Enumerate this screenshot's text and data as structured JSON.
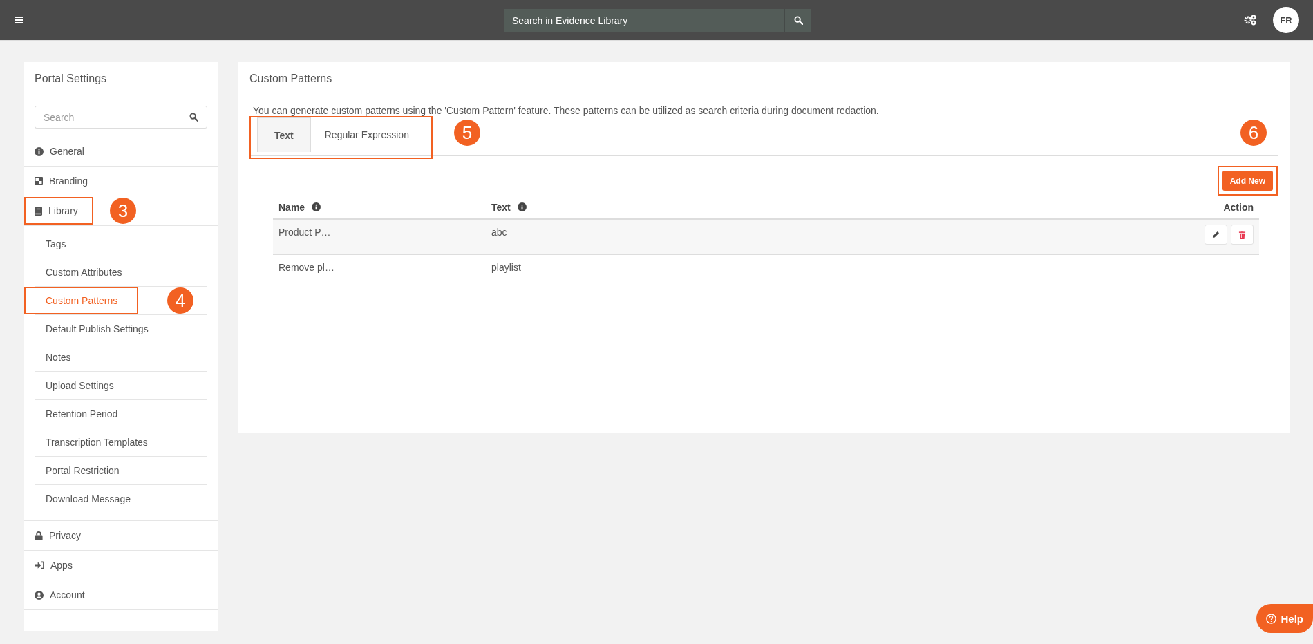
{
  "topbar": {
    "search": {
      "placeholder": "Search in Evidence Library"
    },
    "avatar": "FR"
  },
  "sidebar": {
    "title": "Portal Settings",
    "search": {
      "placeholder": "Search"
    },
    "items": [
      {
        "label": "General",
        "kind": "info",
        "selected": false
      },
      {
        "label": "Branding",
        "kind": "branding",
        "selected": false
      },
      {
        "label": "Library",
        "kind": "book",
        "selected": false,
        "callout": "3",
        "children": [
          {
            "label": "Tags",
            "selected": false
          },
          {
            "label": "Custom Attributes",
            "selected": false
          },
          {
            "label": "Custom Patterns",
            "selected": true,
            "callout": "4"
          },
          {
            "label": "Default Publish Settings",
            "selected": false
          },
          {
            "label": "Notes",
            "selected": false
          },
          {
            "label": "Upload Settings",
            "selected": false
          },
          {
            "label": "Retention Period",
            "selected": false
          },
          {
            "label": "Transcription Templates",
            "selected": false
          },
          {
            "label": "Portal Restriction",
            "selected": false
          },
          {
            "label": "Download Message",
            "selected": false
          }
        ]
      },
      {
        "label": "Privacy",
        "kind": "lock",
        "selected": false
      },
      {
        "label": "Apps",
        "kind": "signin",
        "selected": false
      },
      {
        "label": "Account",
        "kind": "user",
        "selected": false
      }
    ]
  },
  "main": {
    "title": "Custom Patterns",
    "description": "You can generate custom patterns using the 'Custom Pattern' feature. These patterns can be utilized as search criteria during document redaction.",
    "tabs": [
      {
        "label": "Text",
        "selected": true
      },
      {
        "label": "Regular Expression",
        "selected": false
      }
    ],
    "tabs_callout": "5",
    "add_button": {
      "label": "Add New",
      "callout": "6"
    },
    "table": {
      "columns": [
        {
          "label": "Name",
          "info": true
        },
        {
          "label": "Text",
          "info": true
        },
        {
          "label": "Action",
          "info": false
        }
      ],
      "rows": [
        {
          "cells": [
            "Product P…",
            "abc"
          ],
          "hovered": true
        },
        {
          "cells": [
            "Remove pl…",
            "playlist"
          ],
          "hovered": false
        }
      ]
    }
  },
  "help": "Help"
}
